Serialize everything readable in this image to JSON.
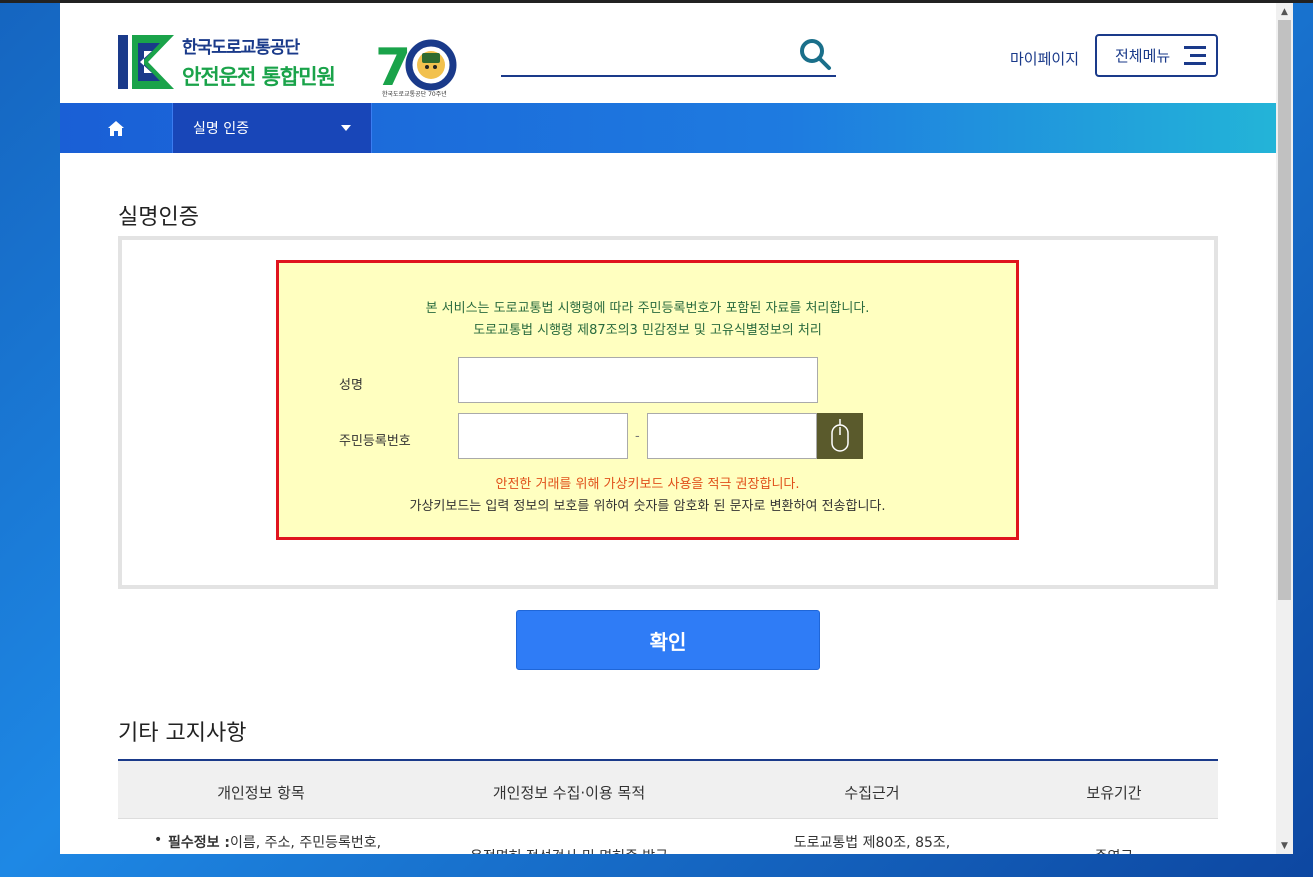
{
  "header": {
    "logo_line1": "한국도로교통공단",
    "logo_line2": "안전운전 통합민원",
    "anniversary_caption": "한국도로교통공단 70주년",
    "mypage": "마이페이지",
    "allmenu": "전체메뉴"
  },
  "nav": {
    "selected": "실명 인증"
  },
  "page": {
    "title": "실명인증"
  },
  "notice": {
    "line1": "본 서비스는 도로교통법 시행령에 따라 주민등록번호가 포함된 자료를 처리합니다.",
    "line2": "도로교통법 시행령 제87조의3 민감정보 및 고유식별정보의 처리",
    "name_label": "성명",
    "rrn_label": "주민등록번호",
    "dash": "-",
    "warn": "안전한 거래를 위해 가상키보드 사용을 적극 권장합니다.",
    "info": "가상키보드는 입력 정보의 보호를 위하여 숫자를 암호화 된 문자로 변환하여 전송합니다."
  },
  "confirm_label": "확인",
  "other": {
    "title": "기타 고지사항",
    "columns": [
      "개인정보 항목",
      "개인정보 수집·이용 목적",
      "수집근거",
      "보유기간"
    ],
    "row1": {
      "item_bold": "필수정보 :",
      "item_rest": "이름, 주소, 주민등록번호,",
      "purpose": "운전면허 적성검사 및 면허증 발급",
      "basis": "도로교통법 제80조, 85조,",
      "period": "준영구"
    }
  },
  "colors": {
    "brand_navy": "#1a3a8a",
    "brand_green": "#1aa34a",
    "notice_bg": "#ffffc0",
    "notice_border": "#e0141e",
    "confirm_bg": "#2f7cf6"
  }
}
